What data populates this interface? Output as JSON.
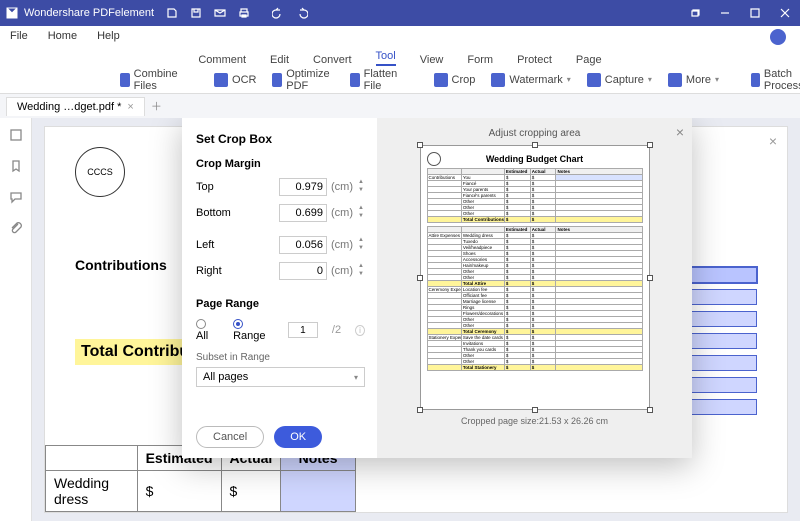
{
  "app": {
    "name": "Wondershare PDFelement"
  },
  "menu": {
    "file": "File",
    "home": "Home",
    "help": "Help"
  },
  "tabs": {
    "comment": "Comment",
    "edit": "Edit",
    "convert": "Convert",
    "tool": "Tool",
    "view": "View",
    "form": "Form",
    "protect": "Protect",
    "page": "Page"
  },
  "ribbon": {
    "combine": "Combine Files",
    "ocr": "OCR",
    "optimize": "Optimize PDF",
    "flatten": "Flatten File",
    "crop": "Crop",
    "watermark": "Watermark",
    "capture": "Capture",
    "more": "More",
    "batch": "Batch Process"
  },
  "doctab": {
    "name": "Wedding …dget.pdf *"
  },
  "doc": {
    "contrib_label": "Contributions",
    "total_contrib": "Total Contributions",
    "cols": {
      "est": "Estimated",
      "act": "Actual",
      "notes": "Notes"
    },
    "row1_label": "Wedding dress",
    "row1_est": "$",
    "row1_act": "$"
  },
  "dialog": {
    "title": "Set Crop Box",
    "margin_header": "Crop Margin",
    "labels": {
      "top": "Top",
      "bottom": "Bottom",
      "left": "Left",
      "right": "Right"
    },
    "values": {
      "top": "0.979",
      "bottom": "0.699",
      "left": "0.056",
      "right": "0"
    },
    "unit": "(cm)",
    "range_header": "Page Range",
    "radio_all": "All",
    "radio_range": "Range",
    "range_value": "1",
    "range_total": "/2",
    "subset_label": "Subset in Range",
    "subset_value": "All pages",
    "cancel": "Cancel",
    "ok": "OK",
    "adjust": "Adjust cropping area",
    "size": "Cropped page size:21.53 x 26.26 cm"
  },
  "preview": {
    "title": "Wedding Budget Chart",
    "cols": {
      "est": "Estimated",
      "act": "Actual",
      "notes": "Notes"
    },
    "groups": {
      "contrib": {
        "name": "Contributions",
        "rows": [
          "You",
          "Fiancé",
          "Your parents",
          "Fiancé's parents",
          "Other",
          "Other",
          "Other"
        ],
        "total": "Total Contributions"
      },
      "attire": {
        "name": "Attire Expenses",
        "rows": [
          "Wedding dress",
          "Tuxedo",
          "Veil/headpiece",
          "Shoes",
          "Accessories",
          "Hair/makeup",
          "Other",
          "Other"
        ],
        "total": "Total Attire"
      },
      "ceremony": {
        "name": "Ceremony Expenses",
        "rows": [
          "Location fee",
          "Officiant fee",
          "Marriage license",
          "Rings",
          "Flowers/decorations",
          "Other",
          "Other"
        ],
        "total": "Total Ceremony"
      },
      "stationery": {
        "name": "Stationery Expenses",
        "rows": [
          "Save the date cards",
          "Invitations",
          "Thank you cards",
          "Other",
          "Other"
        ],
        "total": "Total Stationery"
      }
    },
    "dollar": "$"
  }
}
